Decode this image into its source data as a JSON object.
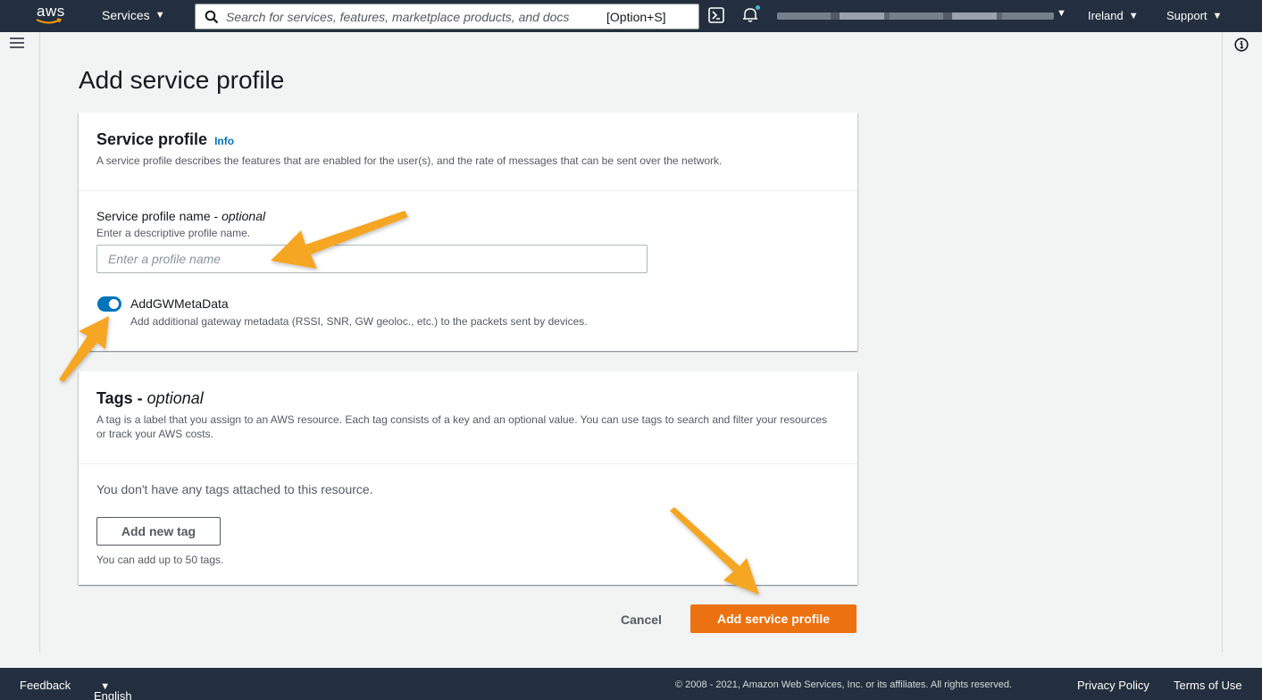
{
  "nav": {
    "logo_text": "aws",
    "services_label": "Services",
    "caret": "▼",
    "search_placeholder": "Search for services, features, marketplace products, and docs",
    "search_shortcut": "[Option+S]",
    "region_label": "Ireland",
    "support_label": "Support"
  },
  "page": {
    "title": "Add service profile"
  },
  "service_profile": {
    "title": "Service profile",
    "info_link": "Info",
    "description": "A service profile describes the features that are enabled for the user(s), and the rate of messages that can be sent over the network.",
    "name_label": "Service profile name - ",
    "name_label_optional": "optional",
    "name_hint": "Enter a descriptive profile name.",
    "name_value": "",
    "name_placeholder": "Enter a profile name",
    "toggle_label": "AddGWMetaData",
    "toggle_description": "Add additional gateway metadata (RSSI, SNR, GW geoloc., etc.) to the packets sent by devices.",
    "toggle_on": true
  },
  "tags": {
    "title": "Tags - ",
    "title_optional": "optional",
    "description": "A tag is a label that you assign to an AWS resource. Each tag consists of a key and an optional value. You can use tags to search and filter your resources or track your AWS costs.",
    "empty_text": "You don't have any tags attached to this resource.",
    "add_button": "Add new tag",
    "limit_hint": "You can add up to 50 tags."
  },
  "actions": {
    "cancel": "Cancel",
    "submit": "Add service profile"
  },
  "footer": {
    "feedback": "Feedback",
    "language": "English (US)",
    "copyright": "© 2008 - 2021, Amazon Web Services, Inc. or its affiliates. All rights reserved.",
    "privacy": "Privacy Policy",
    "terms": "Terms of Use"
  },
  "colors": {
    "nav_bg": "#232f3e",
    "accent_orange": "#ec7211",
    "link_blue": "#0073bb",
    "annotation_arrow": "#f5a623"
  }
}
